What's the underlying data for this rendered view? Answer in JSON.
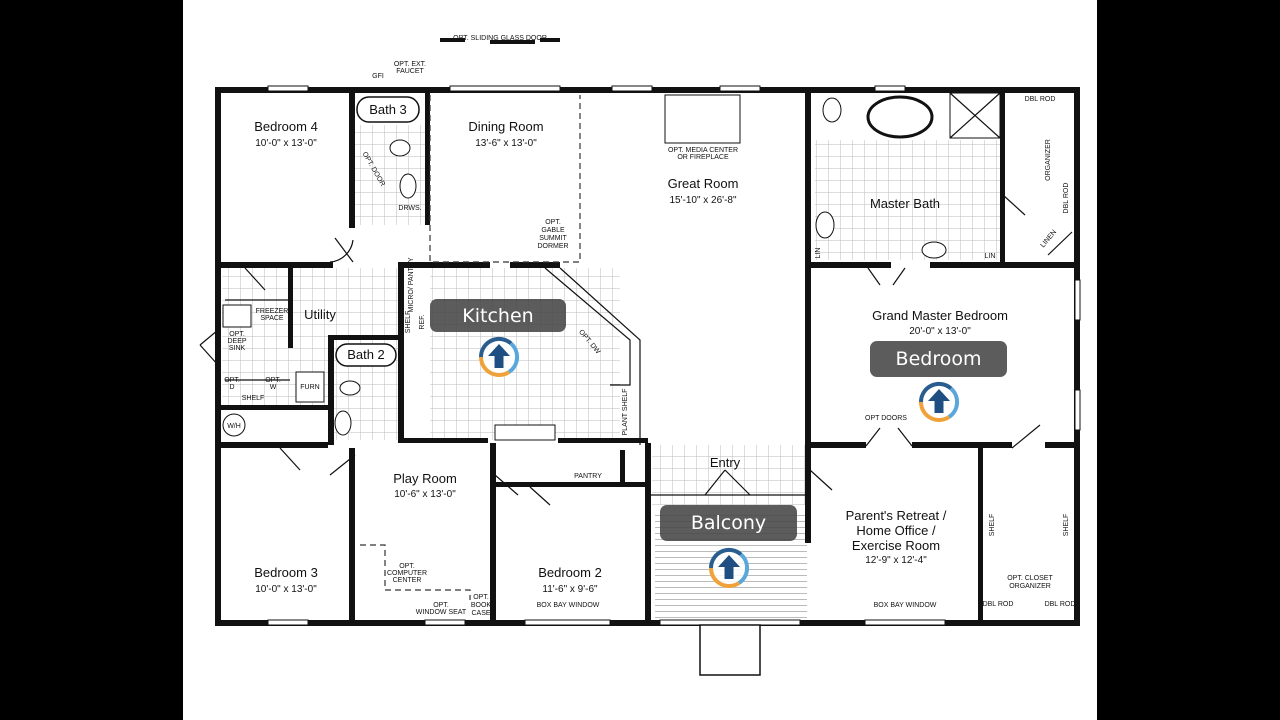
{
  "plan": {
    "top_note": "OPT. SLIDING GLASS DOOR",
    "gfi": "GFI",
    "faucet": [
      "OPT. EXT.",
      "FAUCET"
    ],
    "rooms": {
      "bedroom4": {
        "name": "Bedroom 4",
        "dim": "10'-0\" x 13'-0\""
      },
      "bath3": {
        "name": "Bath 3"
      },
      "dining": {
        "name": "Dining Room",
        "dim": "13'-6\" x 13'-0\""
      },
      "great": {
        "name": "Great Room",
        "dim": "15'-10\" x 26'-8\""
      },
      "master_bath": {
        "name": "Master Bath"
      },
      "utility": {
        "name": "Utility"
      },
      "bath2": {
        "name": "Bath 2"
      },
      "grand_master": {
        "name": "Grand Master Bedroom",
        "dim": "20'-0\" x 13'-0\""
      },
      "play": {
        "name": "Play Room",
        "dim": "10'-6\" x 13'-0\""
      },
      "bedroom3": {
        "name": "Bedroom 3",
        "dim": "10'-0\" x 13'-0\""
      },
      "bedroom2": {
        "name": "Bedroom 2",
        "dim": "11'-6\" x 9'-6\""
      },
      "entry": {
        "name": "Entry"
      },
      "parents": {
        "name": [
          "Parent's Retreat /",
          "Home Office /",
          "Exercise Room"
        ],
        "dim": "12'-9\" x 12'-4\""
      }
    },
    "notes": {
      "opt_door": "OPT. DOOR",
      "drws": "DRWS.",
      "dormer": [
        "OPT.",
        "GABLE",
        "SUMMIT",
        "DORMER"
      ],
      "media": [
        "OPT. MEDIA CENTER",
        "OR FIREPLACE"
      ],
      "dbl_rod": "DBL ROD",
      "organizer": "ORGANIZER",
      "linen": "LINEN",
      "lin": "LIN",
      "freezer": [
        "FREEZER",
        "SPACE"
      ],
      "deep_sink": [
        "OPT.",
        "DEEP",
        "SINK"
      ],
      "opt_d": [
        "OPT.",
        "D"
      ],
      "opt_w": [
        "OPT.",
        "W"
      ],
      "shelf": "SHELF",
      "wh": "W/H",
      "furn": "FURN",
      "micro": "MICRO/ PANTRY",
      "ref": "REF.",
      "opt_dw": "OPT. DW",
      "plant_shelf": "PLANT SHELF",
      "pantry": "PANTRY",
      "opt_doors": "OPT DOORS",
      "computer": [
        "OPT.",
        "COMPUTER",
        "CENTER"
      ],
      "window_seat": [
        "OPT.",
        "WINDOW SEAT"
      ],
      "book_case": [
        "OPT.",
        "BOOK",
        "CASE"
      ],
      "box_bay": "BOX BAY WINDOW",
      "closet_org": [
        "OPT. CLOSET",
        "ORGANIZER"
      ]
    }
  },
  "tour": {
    "labels": {
      "kitchen": "Kitchen",
      "bedroom": "Bedroom",
      "balcony": "Balcony"
    },
    "hotspot_icon": "up-arrow-icon",
    "colors": {
      "ring_blue": "#2a5d8f",
      "ring_light": "#5aa7dc",
      "ring_orange": "#f0a23a",
      "arrow": "#1f4f82",
      "pill": "#464646"
    }
  }
}
